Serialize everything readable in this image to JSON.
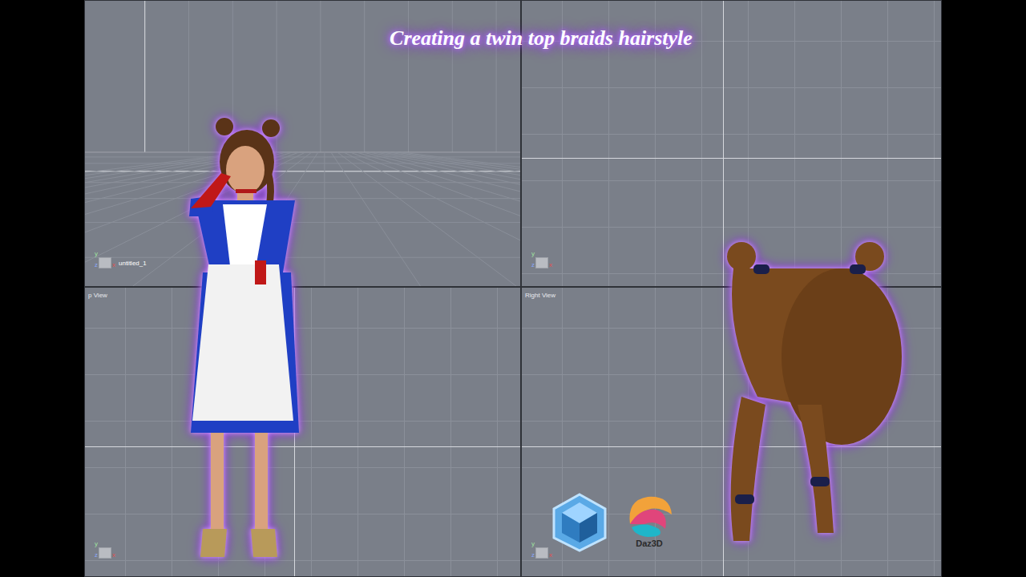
{
  "title": "Creating a twin top braids hairstyle",
  "viewports": [
    {
      "label": "untitled_1",
      "kind": "perspective"
    },
    {
      "label": "",
      "kind": "front"
    },
    {
      "label": "p View",
      "kind": "top"
    },
    {
      "label": "Right View",
      "kind": "right"
    }
  ],
  "axis_labels": [
    "y",
    "z",
    "x"
  ],
  "logo_text": "Daz3D"
}
